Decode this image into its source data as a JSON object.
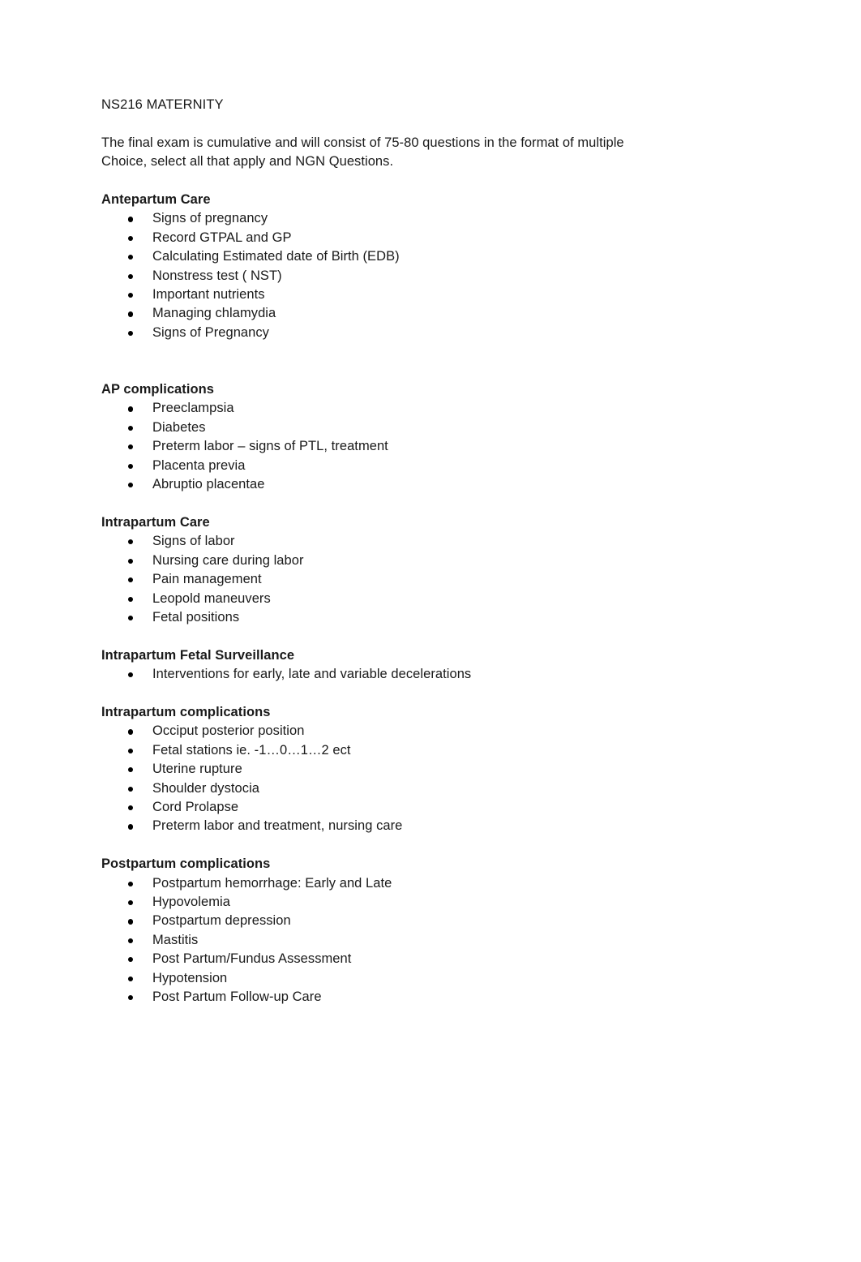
{
  "document": {
    "title": "NS216 MATERNITY",
    "intro": "The final exam is cumulative and will consist of 75-80 questions in the format of multiple Choice, select all that apply and NGN Questions.",
    "bullet_glyph": "•",
    "text_color": "#1a1a1a",
    "background_color": "#ffffff",
    "sections": [
      {
        "heading": "Antepartum Care",
        "items": [
          "Signs of pregnancy",
          "Record GTPAL and GP",
          "Calculating Estimated date of Birth (EDB)",
          "Nonstress test ( NST)",
          "Important nutrients",
          "Managing chlamydia",
          "Signs of Pregnancy"
        ]
      },
      {
        "heading": "AP complications",
        "items": [
          "Preeclampsia",
          "Diabetes",
          "Preterm labor – signs of PTL, treatment",
          "Placenta previa",
          "Abruptio placentae"
        ]
      },
      {
        "heading": "Intrapartum Care",
        "items": [
          "Signs of labor",
          "Nursing care during labor",
          "Pain management",
          "Leopold maneuvers",
          "Fetal positions"
        ]
      },
      {
        "heading": "Intrapartum Fetal Surveillance",
        "items": [
          "Interventions for early, late and variable decelerations"
        ]
      },
      {
        "heading": "Intrapartum complications",
        "items": [
          "Occiput posterior position",
          "Fetal stations ie. -1…0…1…2 ect",
          "Uterine rupture",
          "Shoulder dystocia",
          "Cord Prolapse",
          "Preterm labor and treatment, nursing care"
        ]
      },
      {
        "heading": "Postpartum complications",
        "items": [
          "Postpartum hemorrhage: Early and Late",
          "Hypovolemia",
          "Postpartum depression",
          "Mastitis",
          "Post Partum/Fundus Assessment",
          "Hypotension",
          "Post Partum Follow-up Care"
        ]
      }
    ]
  }
}
